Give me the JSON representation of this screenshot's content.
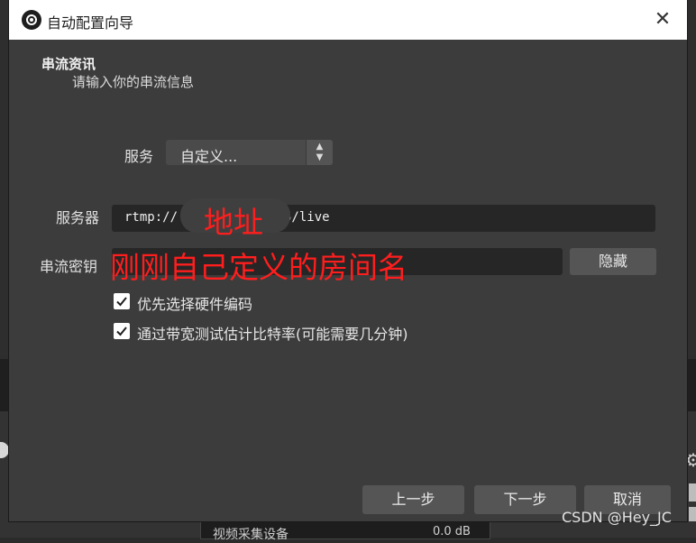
{
  "window": {
    "title": "自动配置向导",
    "close_glyph": "✕"
  },
  "section": {
    "title": "串流资讯",
    "subtitle": "请输入你的串流信息"
  },
  "service": {
    "label": "服务",
    "value": "自定义...",
    "arrows": "⌃⌄"
  },
  "server": {
    "label": "服务器",
    "value": "rtmp://          :1935/live"
  },
  "stream_key": {
    "label": "串流密钥",
    "value": "",
    "hide_label": "隐藏"
  },
  "options": [
    {
      "label": "优先选择硬件编码",
      "checked": true
    },
    {
      "label": "通过带宽测试估计比特率(可能需要几分钟)",
      "checked": true
    }
  ],
  "buttons": {
    "prev": "上一步",
    "next": "下一步",
    "cancel": "取消"
  },
  "annotations": {
    "address": "地址",
    "room_name": "刚刚自己定义的房间名"
  },
  "background": {
    "audio_label": "视频采集设备",
    "audio_db": "0.0 dB",
    "gear_glyph": "⚙"
  },
  "watermark": "CSDN @Hey_JC",
  "colors": {
    "annotation": "#ff1e1e",
    "dialog_bg": "#3c3c3c",
    "input_bg": "#262626"
  },
  "icons": {
    "app": "obs-logo-icon",
    "check": "checkmark-icon"
  }
}
